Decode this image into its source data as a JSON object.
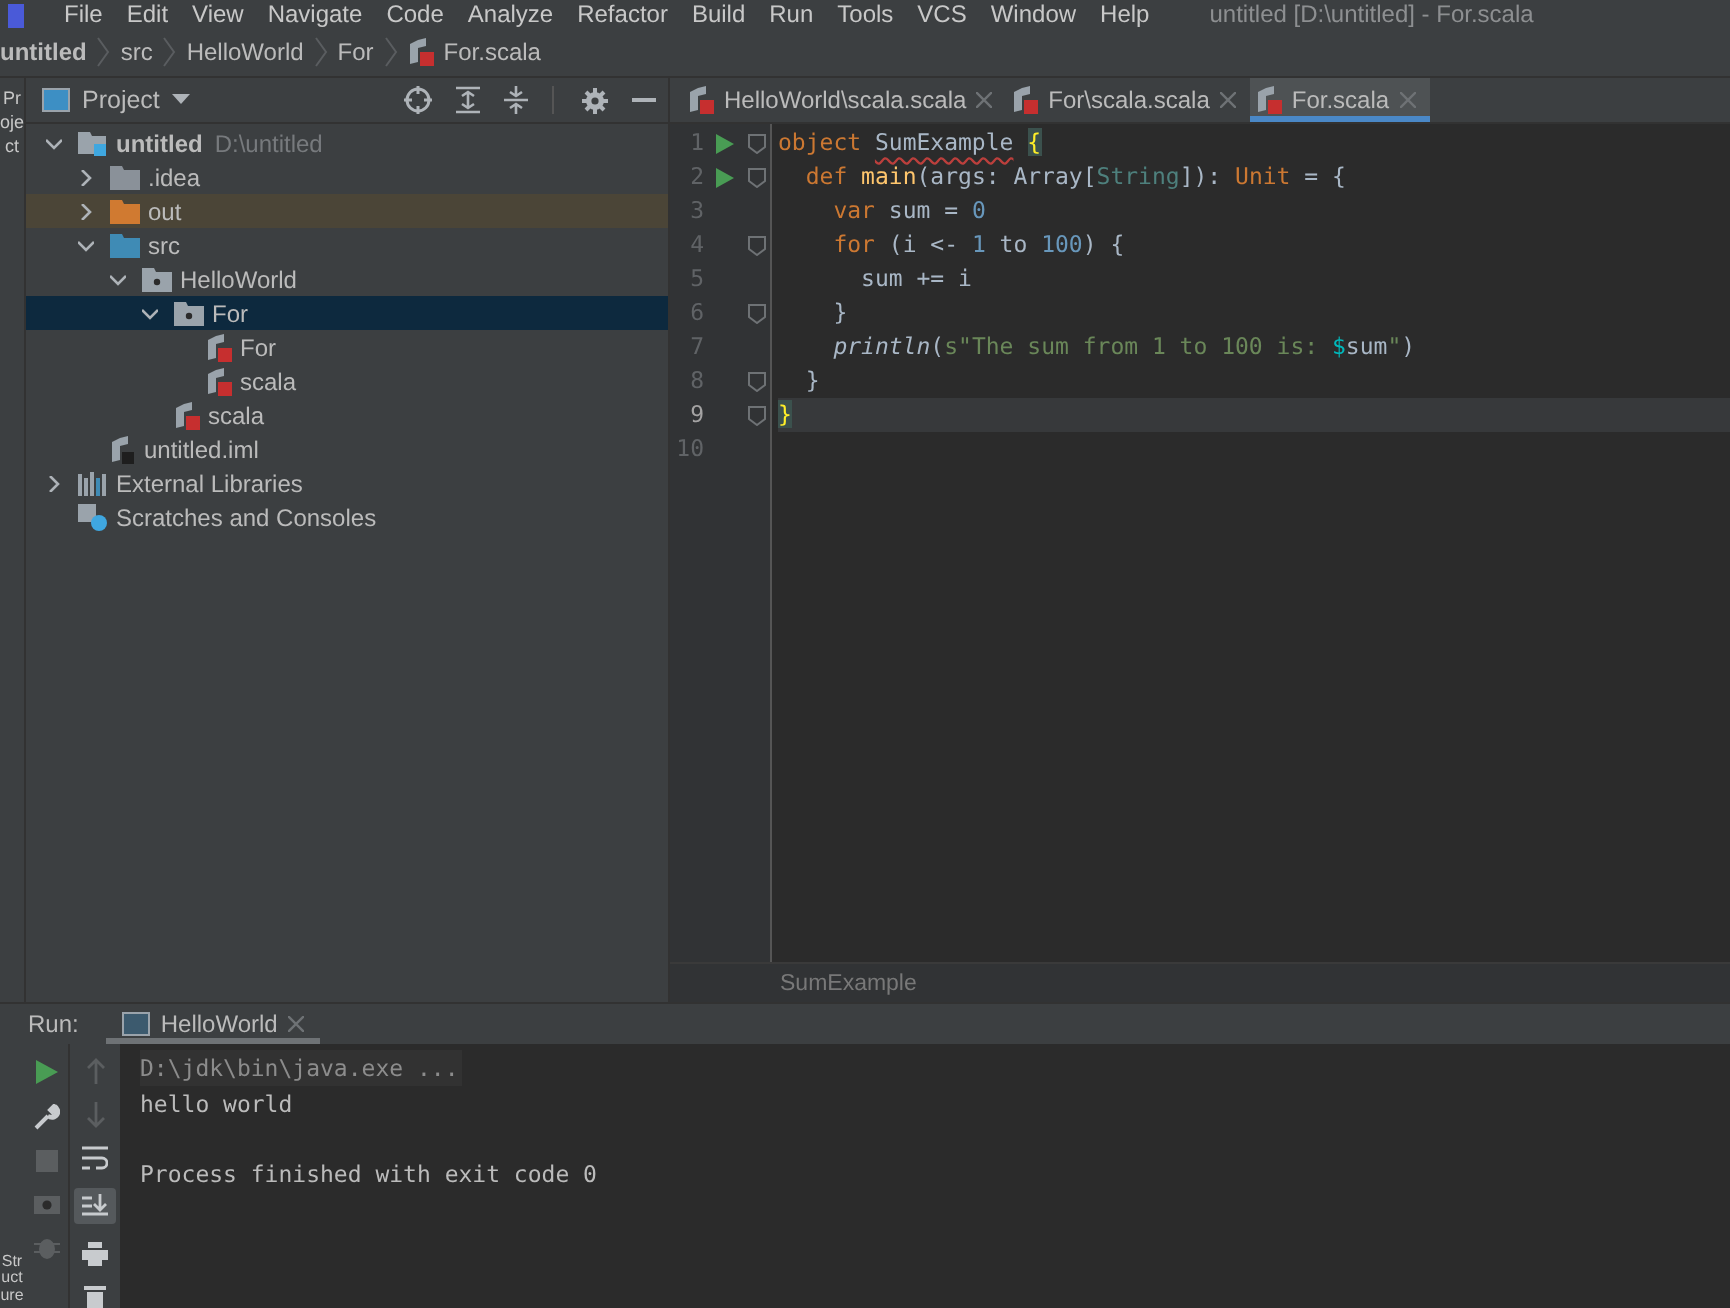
{
  "menu_bar": {
    "items": [
      "File",
      "Edit",
      "View",
      "Navigate",
      "Code",
      "Analyze",
      "Refactor",
      "Build",
      "Run",
      "Tools",
      "VCS",
      "Window",
      "Help"
    ],
    "window_title": "untitled [D:\\untitled] - For.scala"
  },
  "breadcrumbs": [
    {
      "label": "untitled",
      "kind": "project"
    },
    {
      "label": "src",
      "kind": "folder"
    },
    {
      "label": "HelloWorld",
      "kind": "folder"
    },
    {
      "label": "For",
      "kind": "folder"
    },
    {
      "label": "For.scala",
      "kind": "file"
    }
  ],
  "side_stripe": {
    "top": "Project",
    "bottom": "Structure"
  },
  "project_panel": {
    "title": "Project",
    "tree": [
      {
        "label": "untitled",
        "hint": "D:\\untitled",
        "kind": "project",
        "expanded": true,
        "selected": false,
        "children": [
          {
            "label": ".idea",
            "kind": "folder",
            "expanded": false,
            "selected": false
          },
          {
            "label": "out",
            "kind": "excluded",
            "expanded": false,
            "selected": false
          },
          {
            "label": "src",
            "kind": "source",
            "expanded": true,
            "selected": false,
            "children": [
              {
                "label": "HelloWorld",
                "kind": "package",
                "expanded": true,
                "selected": false,
                "children": [
                  {
                    "label": "For",
                    "kind": "package",
                    "expanded": true,
                    "selected": true,
                    "children": [
                      {
                        "label": "For",
                        "kind": "scala",
                        "selected": false
                      },
                      {
                        "label": "scala",
                        "kind": "scala",
                        "selected": false
                      }
                    ]
                  },
                  {
                    "label": "scala",
                    "kind": "scala",
                    "selected": false
                  }
                ]
              }
            ]
          },
          {
            "label": "untitled.iml",
            "kind": "iml",
            "selected": false
          }
        ]
      },
      {
        "label": "External Libraries",
        "kind": "libraries",
        "expanded": false,
        "selected": false
      },
      {
        "label": "Scratches and Consoles",
        "kind": "scratches",
        "selected": false
      }
    ]
  },
  "editor": {
    "tabs": [
      {
        "label": "HelloWorld\\scala.scala",
        "selected": false
      },
      {
        "label": "For\\scala.scala",
        "selected": false
      },
      {
        "label": "For.scala",
        "selected": true
      }
    ],
    "lines": [
      {
        "number": "1",
        "run": true,
        "fold": true,
        "current": false,
        "tokens": [
          {
            "text": "object ",
            "kind": "keyword"
          },
          {
            "text": "SumExample",
            "kind": "typo"
          },
          {
            "text": "{",
            "kind": "brace"
          }
        ]
      },
      {
        "number": "2",
        "run": true,
        "fold": true,
        "current": false,
        "tokens": [
          {
            "text": "  def ",
            "kind": "keyword"
          },
          {
            "text": "main",
            "kind": "function"
          },
          {
            "text": "(args: Array[",
            "kind": "plain"
          },
          {
            "text": "String",
            "kind": "type"
          },
          {
            "text": "]): ",
            "kind": "plain"
          },
          {
            "text": "Unit",
            "kind": "keyword"
          },
          {
            "text": " = {",
            "kind": "plain"
          }
        ]
      },
      {
        "number": "3",
        "run": false,
        "fold": false,
        "current": false,
        "tokens": [
          {
            "text": "    var ",
            "kind": "keyword"
          },
          {
            "text": "sum = ",
            "kind": "plain"
          },
          {
            "text": "0",
            "kind": "number"
          }
        ]
      },
      {
        "number": "4",
        "run": false,
        "fold": true,
        "current": false,
        "tokens": [
          {
            "text": "    for ",
            "kind": "keyword"
          },
          {
            "text": "(i <- ",
            "kind": "plain"
          },
          {
            "text": "1",
            "kind": "number"
          },
          {
            "text": " to ",
            "kind": "plain"
          },
          {
            "text": "100",
            "kind": "number"
          },
          {
            "text": ") {",
            "kind": "plain"
          }
        ]
      },
      {
        "number": "5",
        "run": false,
        "fold": false,
        "current": false,
        "tokens": [
          {
            "text": "      sum += i",
            "kind": "plain"
          }
        ]
      },
      {
        "number": "6",
        "run": false,
        "fold": true,
        "current": false,
        "tokens": [
          {
            "text": "    }",
            "kind": "plain"
          }
        ]
      },
      {
        "number": "7",
        "run": false,
        "fold": false,
        "current": false,
        "tokens": [
          {
            "text": "    println",
            "kind": "italic"
          },
          {
            "text": "(",
            "kind": "plain"
          },
          {
            "text": "s\"The sum from 1 to 100 is: ",
            "kind": "string"
          },
          {
            "text": "$",
            "kind": "interp"
          },
          {
            "text": "sum",
            "kind": "plain"
          },
          {
            "text": "\"",
            "kind": "string"
          },
          {
            "text": ")",
            "kind": "plain"
          }
        ]
      },
      {
        "number": "8",
        "run": false,
        "fold": true,
        "current": false,
        "tokens": [
          {
            "text": "  }",
            "kind": "plain"
          }
        ]
      },
      {
        "number": "9",
        "run": false,
        "fold": true,
        "current": true,
        "tokens": [
          {
            "text": "}",
            "kind": "brace"
          }
        ]
      },
      {
        "number": "10",
        "run": false,
        "fold": false,
        "current": false
      }
    ],
    "breadcrumb": "SumExample"
  },
  "run_panel": {
    "label": "Run:",
    "tabs": [
      {
        "label": "HelloWorld",
        "selected": true
      }
    ],
    "console": [
      {
        "text": "D:\\jdk\\bin\\java.exe ...",
        "kind": "command"
      },
      {
        "text": "hello world",
        "kind": "output"
      },
      {
        "text": "Process finished with exit code 0",
        "kind": "exit"
      }
    ]
  }
}
